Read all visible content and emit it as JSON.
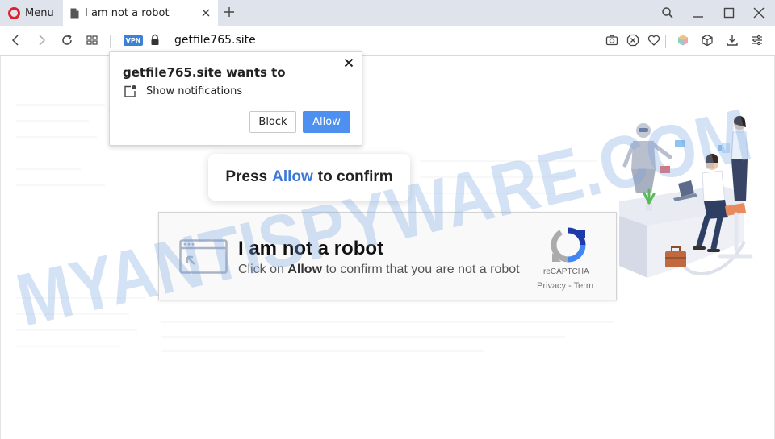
{
  "browser": {
    "menu_label": "Menu",
    "tab_title": "I am not a robot",
    "vpn_label": "VPN",
    "url": "getfile765.site"
  },
  "notification": {
    "title": "getfile765.site wants to",
    "permission": "Show notifications",
    "block_label": "Block",
    "allow_label": "Allow"
  },
  "press_prompt": {
    "before": "Press",
    "highlight": "Allow",
    "after": "to confirm"
  },
  "captcha": {
    "title": "I am not a robot",
    "sub_before": "Click on",
    "sub_bold": "Allow",
    "sub_after": "to confirm that you are not a robot",
    "brand": "reCAPTCHA",
    "links": "Privacy - Term"
  },
  "watermark": "MYANTISPYWARE.COM",
  "colors": {
    "accent_blue": "#4d90f0",
    "highlight_blue": "#3b78d8",
    "opera_red": "#e0202e",
    "tabstrip_bg": "#dfe4ec"
  }
}
